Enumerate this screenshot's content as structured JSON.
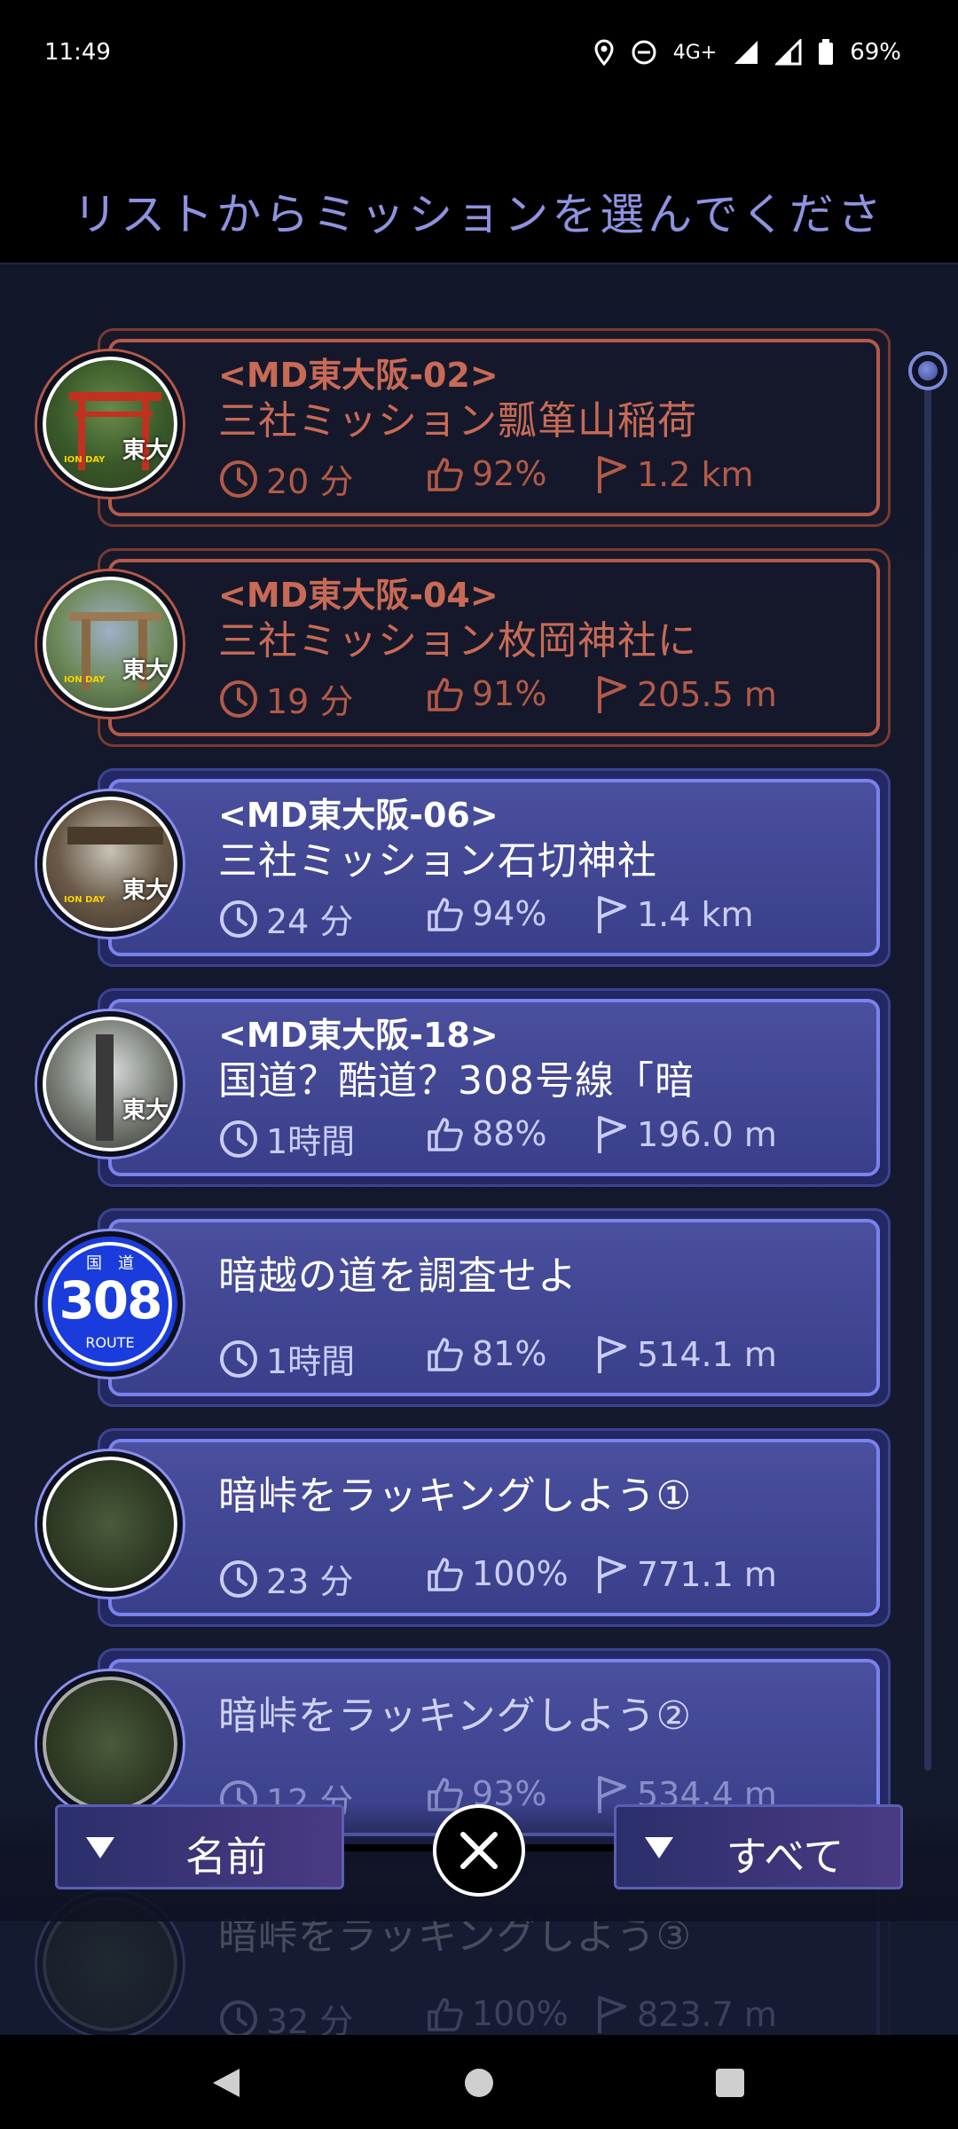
{
  "status_bar": {
    "time": "11:49",
    "network": "4G+",
    "battery": "69%"
  },
  "header": {
    "title": "リストからミッションを選んでくださ"
  },
  "missions": [
    {
      "code": "<MD東大阪-02>",
      "title": "三社ミッション瓢箪山稲荷",
      "time": "20 分",
      "rating": "92%",
      "distance": "1.2 km",
      "avatar_label": "東大",
      "status": "red"
    },
    {
      "code": "<MD東大阪-04>",
      "title": "三社ミッション枚岡神社に",
      "time": "19 分",
      "rating": "91%",
      "distance": "205.5 m",
      "avatar_label": "東大",
      "status": "red"
    },
    {
      "code": "<MD東大阪-06>",
      "title": "三社ミッション石切神社",
      "time": "24 分",
      "rating": "94%",
      "distance": "1.4 km",
      "avatar_label": "東大",
      "status": "blue"
    },
    {
      "code": "<MD東大阪-18>",
      "title": "国道？酷道？308号線「暗",
      "time": "1時間",
      "rating": "88%",
      "distance": "196.0 m",
      "avatar_label": "東大",
      "status": "blue"
    },
    {
      "title": "暗越の道を調査せよ",
      "time": "1時間",
      "rating": "81%",
      "distance": "514.1 m",
      "avatar_route": {
        "top": "国　道",
        "number": "308",
        "bottom": "ROUTE"
      },
      "status": "blue"
    },
    {
      "title": "暗峠をラッキングしよう①",
      "time": "23 分",
      "rating": "100%",
      "distance": "771.1 m",
      "status": "blue"
    },
    {
      "title": "暗峠をラッキングしよう②",
      "time": "12 分",
      "rating": "93%",
      "distance": "534.4 m",
      "status": "blue"
    },
    {
      "title": "暗峠をラッキングしよう③",
      "time": "32 分",
      "rating": "100%",
      "distance": "823.7 m",
      "status": "blue"
    }
  ],
  "controls": {
    "sort_label": "名前",
    "filter_label": "すべて"
  },
  "colors": {
    "red_accent": "#b4594a",
    "blue_accent": "#7a82ee",
    "header_text": "#8e93e0"
  },
  "icons": {
    "time": "clock-icon",
    "rating": "thumbs-up-icon",
    "distance": "flag-icon",
    "close": "close-x-icon"
  }
}
